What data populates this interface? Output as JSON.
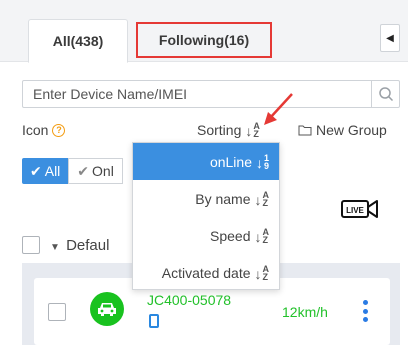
{
  "tabs": {
    "all_label": "All(438)",
    "following_label": "Following(16)"
  },
  "search": {
    "placeholder": "Enter Device Name/IMEI"
  },
  "options": {
    "icon_label": "Icon",
    "sorting_label": "Sorting",
    "new_group_label": "New Group"
  },
  "filters": {
    "all_label": "All",
    "online_label": "Onl"
  },
  "sort_menu": {
    "items": [
      {
        "label": "onLine",
        "glyph_top": "1",
        "glyph_bottom": "9",
        "active": true
      },
      {
        "label": "By name",
        "glyph_top": "A",
        "glyph_bottom": "Z",
        "active": false
      },
      {
        "label": "Speed",
        "glyph_top": "A",
        "glyph_bottom": "Z",
        "active": false
      },
      {
        "label": "Activated date",
        "glyph_top": "A",
        "glyph_bottom": "Z",
        "active": false
      }
    ]
  },
  "group": {
    "label": "Defaul"
  },
  "device": {
    "name": "JC400-05078",
    "speed": "12km/h",
    "status_color": "#19c21f"
  },
  "live_icon": {
    "label": "LIVE"
  },
  "colors": {
    "accent": "#3b8fe0",
    "online_green": "#22c12a",
    "highlight_red": "#e53935"
  }
}
